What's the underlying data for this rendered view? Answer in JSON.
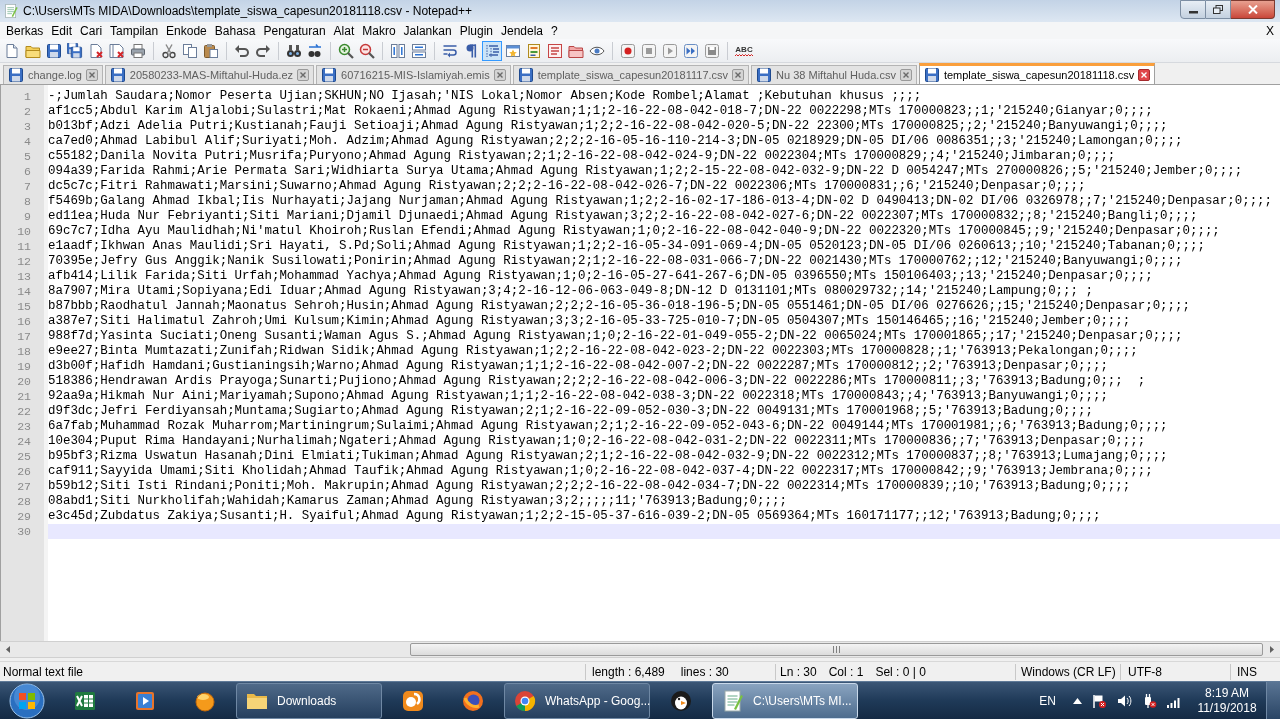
{
  "window": {
    "title": "C:\\Users\\MTs MIDA\\Downloads\\template_siswa_capesun20181118.csv - Notepad++"
  },
  "menu": {
    "items": [
      "Berkas",
      "Edit",
      "Cari",
      "Tampilan",
      "Enkode",
      "Bahasa",
      "Pengaturan",
      "Alat",
      "Makro",
      "Jalankan",
      "Plugin",
      "Jendela",
      "?"
    ],
    "close_label": "X"
  },
  "toolbar": [
    {
      "kind": "new",
      "pressed": false
    },
    {
      "kind": "open",
      "pressed": false
    },
    {
      "kind": "save",
      "pressed": false
    },
    {
      "kind": "saveall",
      "pressed": false
    },
    {
      "kind": "close",
      "pressed": false
    },
    {
      "kind": "closeall",
      "pressed": false
    },
    {
      "kind": "print",
      "pressed": false
    },
    {
      "kind": "separator"
    },
    {
      "kind": "cut",
      "pressed": false
    },
    {
      "kind": "copy",
      "pressed": false
    },
    {
      "kind": "paste",
      "pressed": false
    },
    {
      "kind": "separator"
    },
    {
      "kind": "undo",
      "pressed": false
    },
    {
      "kind": "redo",
      "pressed": false
    },
    {
      "kind": "separator"
    },
    {
      "kind": "find",
      "pressed": false
    },
    {
      "kind": "replace",
      "pressed": false
    },
    {
      "kind": "separator"
    },
    {
      "kind": "zoomin",
      "pressed": false
    },
    {
      "kind": "zoomout",
      "pressed": false
    },
    {
      "kind": "separator"
    },
    {
      "kind": "syncv",
      "pressed": false
    },
    {
      "kind": "synch",
      "pressed": false
    },
    {
      "kind": "separator"
    },
    {
      "kind": "wrap",
      "pressed": false
    },
    {
      "kind": "allchars",
      "pressed": false
    },
    {
      "kind": "indent",
      "pressed": true
    },
    {
      "kind": "udl",
      "pressed": false
    },
    {
      "kind": "docmap",
      "pressed": false
    },
    {
      "kind": "funclist",
      "pressed": false
    },
    {
      "kind": "workspace",
      "pressed": false
    },
    {
      "kind": "monitor",
      "pressed": false
    },
    {
      "kind": "separator"
    },
    {
      "kind": "record",
      "pressed": false
    },
    {
      "kind": "stop",
      "pressed": false
    },
    {
      "kind": "play",
      "pressed": false
    },
    {
      "kind": "playmulti",
      "pressed": false
    },
    {
      "kind": "savemacro",
      "pressed": false
    },
    {
      "kind": "separator"
    },
    {
      "kind": "spellcheck",
      "label": "ABC"
    }
  ],
  "tabs": [
    {
      "label": "change.log",
      "selected": false
    },
    {
      "label": "20580233-MAS-Miftahul-Huda.ez",
      "selected": false
    },
    {
      "label": "60716215-MIS-Islamiyah.emis",
      "selected": false
    },
    {
      "label": "template_siswa_capesun20181117.csv",
      "selected": false
    },
    {
      "label": "Nu 38 Miftahul Huda.csv",
      "selected": false
    },
    {
      "label": "template_siswa_capesun20181118.csv",
      "selected": true
    }
  ],
  "editor": {
    "lines": [
      {
        "number": "1",
        "text": "-;Jumlah Saudara;Nomor Peserta Ujian;SKHUN;NO Ijasah;'NIS Lokal;Nomor Absen;Kode Rombel;Alamat ;Kebutuhan khusus ;;;;",
        "current": false
      },
      {
        "number": "2",
        "text": "af1cc5;Abdul Karim Aljalobi;Sulastri;Mat Rokaeni;Ahmad Agung Ristyawan;1;1;2-16-22-08-042-018-7;DN-22 0022298;MTs 170000823;;1;'215240;Gianyar;0;;;;",
        "current": false
      },
      {
        "number": "3",
        "text": "b013bf;Adzi Adelia Putri;Kustianah;Fauji Setioaji;Ahmad Agung Ristyawan;1;2;2-16-22-08-042-020-5;DN-22 22300;MTs 170000825;;2;'215240;Banyuwangi;0;;;;",
        "current": false
      },
      {
        "number": "4",
        "text": "ca7ed0;Ahmad Labibul Alif;Suriyati;Moh. Adzim;Ahmad Agung Ristyawan;2;2;2-16-05-16-110-214-3;DN-05 0218929;DN-05 DI/06 0086351;;3;'215240;Lamongan;0;;;;",
        "current": false
      },
      {
        "number": "5",
        "text": "c55182;Danila Novita Putri;Musrifa;Puryono;Ahmad Agung Ristyawan;2;1;2-16-22-08-042-024-9;DN-22 0022304;MTs 170000829;;4;'215240;Jimbaran;0;;;;",
        "current": false
      },
      {
        "number": "6",
        "text": "094a39;Farida Rahmi;Arie Permata Sari;Widhiarta Surya Utama;Ahmad Agung Ristyawan;1;2;2-15-22-08-042-032-9;DN-22 D 0054247;MTs 270000826;;5;'215240;Jember;0;;;;",
        "current": false
      },
      {
        "number": "7",
        "text": "dc5c7c;Fitri Rahmawati;Marsini;Suwarno;Ahmad Agung Ristyawan;2;2;2-16-22-08-042-026-7;DN-22 0022306;MTs 170000831;;6;'215240;Denpasar;0;;;;",
        "current": false
      },
      {
        "number": "8",
        "text": "f5469b;Galang Ahmad Ikbal;Iis Nurhayati;Jajang Nurjaman;Ahmad Agung Ristyawan;1;2;2-16-02-17-186-013-4;DN-02 D 0490413;DN-02 DI/06 0326978;;7;'215240;Denpasar;0;;;;",
        "current": false
      },
      {
        "number": "9",
        "text": "ed11ea;Huda Nur Febriyanti;Siti Mariani;Djamil Djunaedi;Ahmad Agung Ristyawan;3;2;2-16-22-08-042-027-6;DN-22 0022307;MTs 170000832;;8;'215240;Bangli;0;;;;",
        "current": false
      },
      {
        "number": "10",
        "text": "69c7c7;Idha Ayu Maulidhah;Ni'matul Khoiroh;Ruslan Efendi;Ahmad Agung Ristyawan;1;0;2-16-22-08-042-040-9;DN-22 0022320;MTs 170000845;;9;'215240;Denpasar;0;;;;",
        "current": false
      },
      {
        "number": "11",
        "text": "e1aadf;Ikhwan Anas Maulidi;Sri Hayati, S.Pd;Soli;Ahmad Agung Ristyawan;1;2;2-16-05-34-091-069-4;DN-05 0520123;DN-05 DI/06 0260613;;10;'215240;Tabanan;0;;;;",
        "current": false
      },
      {
        "number": "12",
        "text": "70395e;Jefry Gus Anggik;Nanik Susilowati;Ponirin;Ahmad Agung Ristyawan;2;1;2-16-22-08-031-066-7;DN-22 0021430;MTs 170000762;;12;'215240;Banyuwangi;0;;;;",
        "current": false
      },
      {
        "number": "13",
        "text": "afb414;Lilik Farida;Siti Urfah;Mohammad Yachya;Ahmad Agung Ristyawan;1;0;2-16-05-27-641-267-6;DN-05 0396550;MTs 150106403;;13;'215240;Denpasar;0;;;;",
        "current": false
      },
      {
        "number": "14",
        "text": "8a7907;Mira Utami;Sopiyana;Edi Iduar;Ahmad Agung Ristyawan;3;4;2-16-12-06-063-049-8;DN-12 D 0131101;MTs 080029732;;14;'215240;Lampung;0;;; ;",
        "current": false
      },
      {
        "number": "15",
        "text": "b87bbb;Raodhatul Jannah;Maonatus Sehroh;Husin;Ahmad Agung Ristyawan;2;2;2-16-05-36-018-196-5;DN-05 0551461;DN-05 DI/06 0276626;;15;'215240;Denpasar;0;;;;",
        "current": false
      },
      {
        "number": "16",
        "text": "a387e7;Siti Halimatul Zahroh;Umi Kulsum;Kimin;Ahmad Agung Ristyawan;3;3;2-16-05-33-725-010-7;DN-05 0504307;MTs 150146465;;16;'215240;Jember;0;;;;",
        "current": false
      },
      {
        "number": "17",
        "text": "988f7d;Yasinta Suciati;Oneng Susanti;Waman Agus S.;Ahmad Agung Ristyawan;1;0;2-16-22-01-049-055-2;DN-22 0065024;MTs 170001865;;17;'215240;Denpasar;0;;;;",
        "current": false
      },
      {
        "number": "18",
        "text": "e9ee27;Binta Mumtazati;Zunifah;Ridwan Sidik;Ahmad Agung Ristyawan;1;2;2-16-22-08-042-023-2;DN-22 0022303;MTs 170000828;;1;'763913;Pekalongan;0;;;;",
        "current": false
      },
      {
        "number": "19",
        "text": "d3b00f;Hafidh Hamdani;Gustianingsih;Warno;Ahmad Agung Ristyawan;1;1;2-16-22-08-042-007-2;DN-22 0022287;MTs 170000812;;2;'763913;Denpasar;0;;;;",
        "current": false
      },
      {
        "number": "20",
        "text": "518386;Hendrawan Ardis Prayoga;Sunarti;Pujiono;Ahmad Agung Ristyawan;2;2;2-16-22-08-042-006-3;DN-22 0022286;MTs 170000811;;3;'763913;Badung;0;;;  ;",
        "current": false
      },
      {
        "number": "21",
        "text": "92aa9a;Hikmah Nur Aini;Mariyamah;Supono;Ahmad Agung Ristyawan;1;1;2-16-22-08-042-038-3;DN-22 0022318;MTs 170000843;;4;'763913;Banyuwangi;0;;;;",
        "current": false
      },
      {
        "number": "22",
        "text": "d9f3dc;Jefri Ferdiyansah;Muntama;Sugiarto;Ahmad Agung Ristyawan;2;1;2-16-22-09-052-030-3;DN-22 0049131;MTs 170001968;;5;'763913;Badung;0;;;;",
        "current": false
      },
      {
        "number": "23",
        "text": "6a7fab;Muhammad Rozak Muharrom;Martiningrum;Sulaimi;Ahmad Agung Ristyawan;2;1;2-16-22-09-052-043-6;DN-22 0049144;MTs 170001981;;6;'763913;Badung;0;;;;",
        "current": false
      },
      {
        "number": "24",
        "text": "10e304;Puput Rima Handayani;Nurhalimah;Ngateri;Ahmad Agung Ristyawan;1;0;2-16-22-08-042-031-2;DN-22 0022311;MTs 170000836;;7;'763913;Denpasar;0;;;;",
        "current": false
      },
      {
        "number": "25",
        "text": "b95bf3;Rizma Uswatun Hasanah;Dini Elmiati;Tukiman;Ahmad Agung Ristyawan;2;1;2-16-22-08-042-032-9;DN-22 0022312;MTs 170000837;;8;'763913;Lumajang;0;;;;",
        "current": false
      },
      {
        "number": "26",
        "text": "caf911;Sayyida Umami;Siti Kholidah;Ahmad Taufik;Ahmad Agung Ristyawan;1;0;2-16-22-08-042-037-4;DN-22 0022317;MTs 170000842;;9;'763913;Jembrana;0;;;;",
        "current": false
      },
      {
        "number": "27",
        "text": "b59b12;Siti Isti Rindani;Poniti;Moh. Makrupin;Ahmad Agung Ristyawan;2;2;2-16-22-08-042-034-7;DN-22 0022314;MTs 170000839;;10;'763913;Badung;0;;;;",
        "current": false
      },
      {
        "number": "28",
        "text": "08abd1;Siti Nurkholifah;Wahidah;Kamarus Zaman;Ahmad Agung Ristyawan;3;2;;;;;11;'763913;Badung;0;;;;",
        "current": false
      },
      {
        "number": "29",
        "text": "e3c45d;Zubdatus Zakiya;Susanti;H. Syaiful;Ahmad Agung Ristyawan;1;2;2-15-05-37-616-039-2;DN-05 0569364;MTs 160171177;;12;'763913;Badung;0;;;;",
        "current": false
      },
      {
        "number": "30",
        "current": true
      }
    ]
  },
  "status_bar": {
    "file_type": "Normal text file",
    "length": "length : 6,489",
    "lines": "lines : 30",
    "ln": "Ln : 30",
    "col": "Col : 1",
    "sel": "Sel : 0 | 0",
    "eol": "Windows (CR LF)",
    "encoding": "UTF-8",
    "mode": "INS"
  },
  "taskbar": {
    "items": [
      {
        "kind": "start"
      },
      {
        "kind": "spreadsheet"
      },
      {
        "kind": "player"
      },
      {
        "kind": "ball"
      },
      {
        "kind": "folder",
        "label": "Downloads",
        "selected": false
      },
      {
        "kind": "squirrel"
      },
      {
        "kind": "fox"
      },
      {
        "kind": "wheel",
        "label": "WhatsApp - Goog...",
        "selected": false
      },
      {
        "kind": "bird"
      },
      {
        "kind": "notepad",
        "label": "C:\\Users\\MTs MI...",
        "selected": true
      }
    ],
    "tray": {
      "language": "EN",
      "time": "8:19 AM",
      "date": "11/19/2018"
    }
  }
}
